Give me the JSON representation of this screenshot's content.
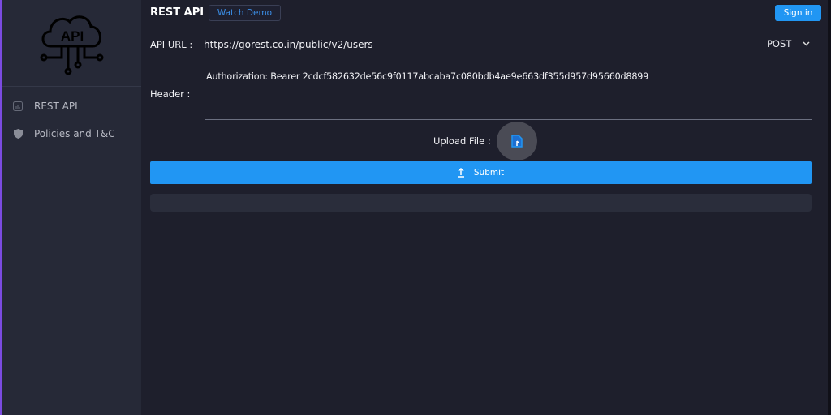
{
  "sidebar": {
    "logo_text": "API",
    "items": [
      {
        "label": "REST API",
        "icon": "chart-icon"
      },
      {
        "label": "Policies and T&C",
        "icon": "shield-icon"
      }
    ]
  },
  "header": {
    "title": "REST API",
    "watch_demo": "Watch Demo",
    "sign_in": "Sign in"
  },
  "form": {
    "api_url_label": "API URL :",
    "api_url_value": "https://gorest.co.in/public/v2/users",
    "method": "POST",
    "header_label": "Header :",
    "header_value": "Authorization: Bearer 2cdcf582632de56c9f0117abcaba7c080bdb4ae9e663df355d957d95660d8899",
    "upload_label": "Upload File :",
    "submit_label": "Submit"
  },
  "colors": {
    "accent": "#2196f3",
    "background": "#1e1f2c",
    "sidebar": "#262937"
  }
}
